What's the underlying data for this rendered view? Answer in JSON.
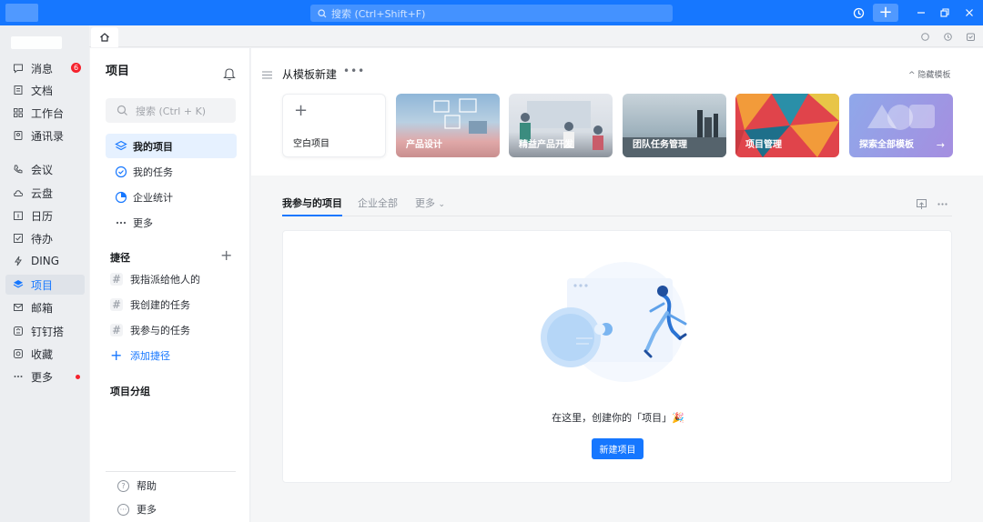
{
  "titlebar": {
    "search_placeholder": "搜索 (Ctrl+Shift+F)",
    "plus": "+"
  },
  "leftnav": {
    "items": [
      {
        "label": "消息",
        "icon": "chat-bubble-icon",
        "badge": "6"
      },
      {
        "label": "文档",
        "icon": "document-icon"
      },
      {
        "label": "工作台",
        "icon": "grid-icon"
      },
      {
        "label": "通讯录",
        "icon": "contacts-icon"
      },
      {
        "label": "会议",
        "icon": "phone-icon"
      },
      {
        "label": "云盘",
        "icon": "cloud-icon"
      },
      {
        "label": "日历",
        "icon": "calendar-icon"
      },
      {
        "label": "待办",
        "icon": "todo-icon"
      },
      {
        "label": "DING",
        "icon": "bolt-icon"
      },
      {
        "label": "项目",
        "icon": "project-icon",
        "active": true
      },
      {
        "label": "邮箱",
        "icon": "mail-icon"
      },
      {
        "label": "钉钉搭",
        "icon": "builder-icon"
      },
      {
        "label": "收藏",
        "icon": "star-box-icon"
      },
      {
        "label": "更多",
        "icon": "more-dots-icon",
        "dot": true
      }
    ]
  },
  "sidebar": {
    "title": "项目",
    "search_placeholder": "搜索 (Ctrl + K)",
    "items": [
      {
        "label": "我的项目"
      },
      {
        "label": "我的任务"
      },
      {
        "label": "企业统计"
      },
      {
        "label": "更多"
      }
    ],
    "shortcuts_title": "捷径",
    "shortcuts": [
      {
        "label": "我指派给他人的"
      },
      {
        "label": "我创建的任务"
      },
      {
        "label": "我参与的任务"
      }
    ],
    "add_shortcut": "添加捷径",
    "groups_title": "项目分组",
    "help": "帮助",
    "more": "更多"
  },
  "main": {
    "template_title": "从模板新建",
    "hide_templates": "^ 隐藏模板",
    "cards": [
      {
        "label": "空白项目"
      },
      {
        "label": "产品设计"
      },
      {
        "label": "精益产品开发"
      },
      {
        "label": "团队任务管理"
      },
      {
        "label": "项目管理"
      },
      {
        "label": "探索全部模板"
      }
    ],
    "tabs": [
      {
        "label": "我参与的项目"
      },
      {
        "label": "企业全部"
      },
      {
        "label": "更多"
      }
    ],
    "empty_text": "在这里，创建你的「项目」🎉",
    "new_project_button": "新建项目"
  },
  "colors": {
    "accent": "#1677ff",
    "badge": "#f5222d"
  }
}
